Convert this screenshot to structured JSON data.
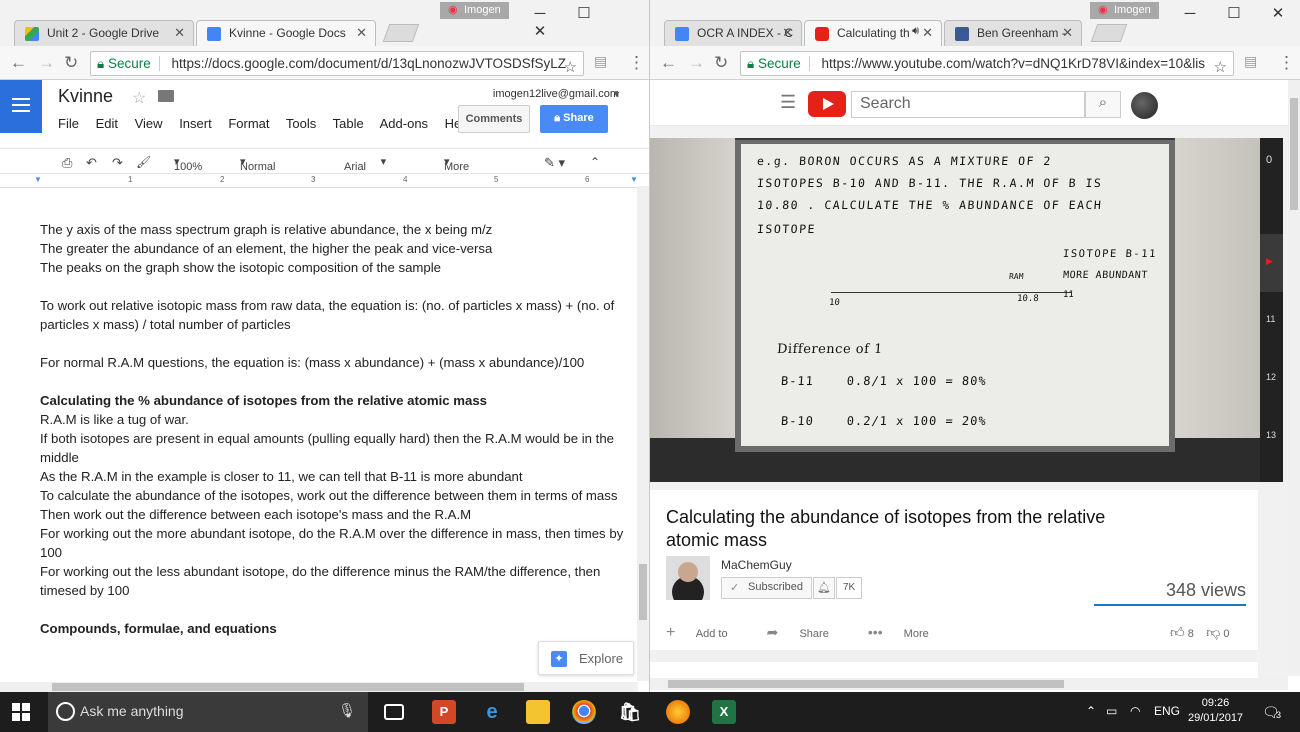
{
  "left_window": {
    "profile": "Imogen",
    "tabs": [
      {
        "label": "Unit 2 - Google Drive"
      },
      {
        "label": "Kvinne - Google Docs"
      }
    ],
    "secure_label": "Secure",
    "url": "https://docs.google.com/document/d/13qLnonozwJVTOSDSfSyLZ",
    "docs": {
      "title": "Kvinne",
      "email": "imogen12live@gmail.com",
      "menu": [
        "File",
        "Edit",
        "View",
        "Insert",
        "Format",
        "Tools",
        "Table",
        "Add-ons",
        "Help"
      ],
      "comments_label": "Comments",
      "share_label": "Share",
      "zoom": "100%",
      "style": "Normal text",
      "font": "Arial",
      "more_label": "More",
      "ruler_marks": [
        "1",
        "2",
        "3",
        "4",
        "5",
        "6"
      ],
      "lines": [
        {
          "text": "The y axis of the mass spectrum graph is relative abundance, the x being m/z",
          "bold": false
        },
        {
          "text": "The greater the abundance of an element, the higher the peak and vice-versa",
          "bold": false
        },
        {
          "text": "The peaks on the graph show the isotopic composition of the sample",
          "bold": false
        },
        {
          "text": "",
          "bold": false
        },
        {
          "text": "To work out relative isotopic mass from raw data, the equation is: (no. of particles x mass) + (no. of particles x mass) / total number of particles",
          "bold": false
        },
        {
          "text": "",
          "bold": false
        },
        {
          "text": "For normal R.A.M questions, the equation is: (mass x abundance) + (mass x abundance)/100",
          "bold": false
        },
        {
          "text": "",
          "bold": false
        },
        {
          "text": "Calculating the % abundance of isotopes from the relative atomic mass",
          "bold": true
        },
        {
          "text": "R.A.M is like a tug of war.",
          "bold": false
        },
        {
          "text": "If both isotopes are present in equal amounts (pulling equally hard) then the R.A.M would be in the middle",
          "bold": false
        },
        {
          "text": "As the R.A.M in the example is closer to 11, we can tell that B-11 is more abundant",
          "bold": false
        },
        {
          "text": "To calculate the abundance of the isotopes, work out the difference between them in terms of mass",
          "bold": false
        },
        {
          "text": "Then work out the difference between each isotope's mass and the R.A.M",
          "bold": false
        },
        {
          "text": "For working out the more abundant isotope, do the R.A.M over the difference in mass, then times by 100",
          "bold": false
        },
        {
          "text": "For working out the less abundant isotope, do the difference minus the RAM/the difference, then timesed by 100",
          "bold": false
        },
        {
          "text": "",
          "bold": false
        },
        {
          "text": "Compounds, formulae, and equations",
          "bold": true
        }
      ],
      "explore_label": "Explore"
    }
  },
  "right_window": {
    "profile": "Imogen",
    "tabs": [
      {
        "label": "OCR A INDEX - C"
      },
      {
        "label": "Calculating th"
      },
      {
        "label": "Ben Greenham -"
      }
    ],
    "secure_label": "Secure",
    "url": "https://www.youtube.com/watch?v=dNQ1KrD78VI&index=10&lis",
    "youtube": {
      "search_placeholder": "Search",
      "board_lines": [
        "e.g. BORON OCCURS AS A MIXTURE OF 2",
        "ISOTOPES B-10 AND B-11. THE R.A.M OF B IS",
        "10.80 . CALCULATE THE % ABUNDANCE OF EACH",
        "ISOTOPE"
      ],
      "board_notes": {
        "isotope": "ISOTOPE B-11",
        "more": "MORE ABUNDANT",
        "ram": "RAM",
        "tick10": "10",
        "tick108": "10.8",
        "tick11": "11",
        "difference": "Difference of 1",
        "b11": "B-11    0.8/1 x 100 = 80%",
        "b10": "B-10    0.2/1 x 100 = 20%"
      },
      "playlist_numbers": [
        "0",
        "11",
        "12",
        "13"
      ],
      "title": "Calculating the abundance of isotopes from the relative atomic mass",
      "channel": "MaChemGuy",
      "subscribed_label": "Subscribed",
      "subscriber_count": "7K",
      "views": "348 views",
      "actions": [
        "Add to",
        "Share",
        "More"
      ],
      "likes": "8",
      "dislikes": "0"
    }
  },
  "taskbar": {
    "search_placeholder": "Ask me anything",
    "language": "ENG",
    "time": "09:26",
    "date": "29/01/2017",
    "notifications": "3"
  }
}
